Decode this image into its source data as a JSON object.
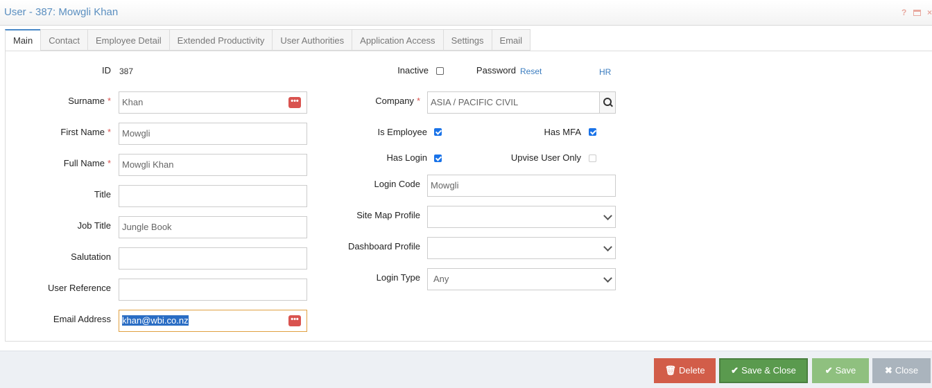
{
  "window": {
    "title": "User - 387: Mowgli Khan",
    "help_icon": "?",
    "close_icon": "×"
  },
  "tabs": [
    {
      "label": "Main",
      "active": true
    },
    {
      "label": "Contact"
    },
    {
      "label": "Employee Detail"
    },
    {
      "label": "Extended Productivity"
    },
    {
      "label": "User Authorities"
    },
    {
      "label": "Application Access"
    },
    {
      "label": "Settings"
    },
    {
      "label": "Email"
    }
  ],
  "form": {
    "required_mark": "*",
    "id": {
      "label": "ID",
      "value": "387"
    },
    "surname": {
      "label": "Surname",
      "value": "Khan"
    },
    "first_name": {
      "label": "First Name",
      "value": "Mowgli"
    },
    "full_name": {
      "label": "Full Name",
      "value": "Mowgli Khan"
    },
    "title": {
      "label": "Title",
      "value": ""
    },
    "job_title": {
      "label": "Job Title",
      "value": "Jungle Book"
    },
    "salutation": {
      "label": "Salutation",
      "value": ""
    },
    "user_reference": {
      "label": "User Reference",
      "value": ""
    },
    "email_address": {
      "label": "Email Address",
      "value": "khan@wbi.co.nz"
    },
    "inactive": {
      "label": "Inactive",
      "checked": false
    },
    "password": {
      "label": "Password",
      "reset_link": "Reset"
    },
    "hr_link": "HR",
    "company": {
      "label": "Company",
      "value": "ASIA / PACIFIC CIVIL"
    },
    "is_employee": {
      "label": "Is Employee",
      "checked": true
    },
    "has_mfa": {
      "label": "Has MFA",
      "checked": true
    },
    "has_login": {
      "label": "Has Login",
      "checked": true
    },
    "upvise_user_only": {
      "label": "Upvise User Only",
      "checked": false
    },
    "login_code": {
      "label": "Login Code",
      "value": "Mowgli"
    },
    "site_map_profile": {
      "label": "Site Map Profile",
      "value": ""
    },
    "dashboard_profile": {
      "label": "Dashboard Profile",
      "value": ""
    },
    "login_type": {
      "label": "Login Type",
      "value": "Any"
    },
    "dots_glyph": "•••"
  },
  "footer": {
    "delete": "Delete",
    "save_close": "Save & Close",
    "save": "Save",
    "close": "Close"
  },
  "colors": {
    "accent": "#4a89c8",
    "required": "#d9534f",
    "delete": "#d25d49",
    "save_close": "#5a9a4e",
    "save": "#8fc07f",
    "close": "#aab4bd"
  }
}
